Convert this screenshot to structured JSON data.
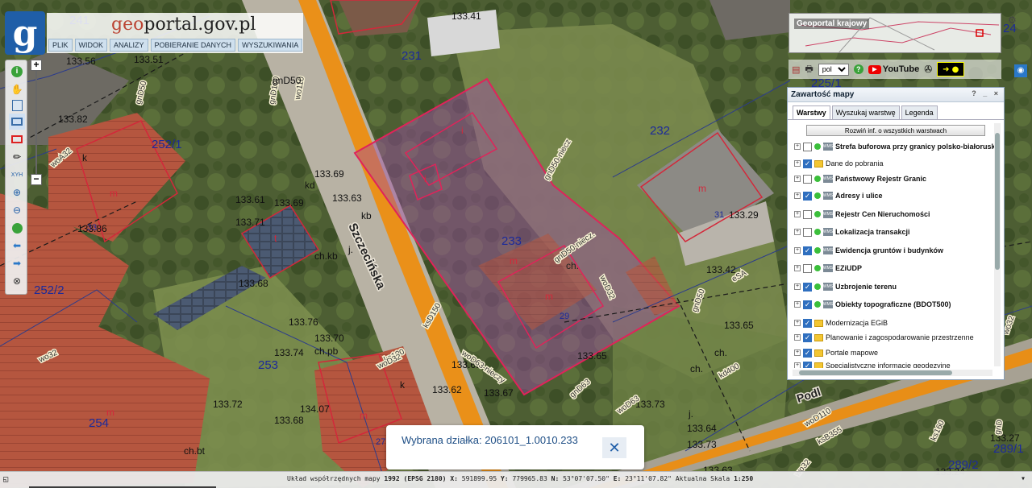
{
  "header": {
    "title_geo": "geo",
    "title_rest": "portal.gov.pl",
    "logo_letter": "g"
  },
  "menu": [
    "PLIK",
    "WIDOK",
    "ANALIZY",
    "POBIERANIE DANYCH",
    "WYSZUKIWANIA"
  ],
  "toolbar": {
    "zoom_in": "+",
    "zoom_out": "−",
    "xyh_label": "XYH"
  },
  "minimap": {
    "title": "Geoportal krajowy"
  },
  "top_icons": {
    "language": "pol",
    "youtube": "YouTube"
  },
  "panel": {
    "title": "Zawartość mapy",
    "controls": "? _ ×",
    "tabs": [
      "Warstwy",
      "Wyszukaj warstwę",
      "Legenda"
    ],
    "expand_button": "Rozwiń inf. o wszystkich warstwach",
    "layers": [
      {
        "label": "Strefa buforowa przy granicy polsko-białoruskiej",
        "checked": false,
        "kind": "wms",
        "bold": true
      },
      {
        "label": "Dane do pobrania",
        "checked": true,
        "kind": "folder",
        "bold": false
      },
      {
        "label": "Państwowy Rejestr Granic",
        "checked": false,
        "kind": "wms",
        "bold": true
      },
      {
        "label": "Adresy i ulice",
        "checked": true,
        "kind": "wms",
        "bold": true
      },
      {
        "label": "Rejestr Cen Nieruchomości",
        "checked": false,
        "kind": "wms",
        "bold": true
      },
      {
        "label": "Lokalizacja transakcji",
        "checked": false,
        "kind": "wms",
        "bold": true
      },
      {
        "label": "Ewidencja gruntów i budynków",
        "checked": true,
        "kind": "wms",
        "bold": true
      },
      {
        "label": "EZiUDP",
        "checked": false,
        "kind": "wms",
        "bold": true
      },
      {
        "label": "Uzbrojenie terenu",
        "checked": true,
        "kind": "wms",
        "bold": true
      },
      {
        "label": "Obiekty topograficzne (BDOT500)",
        "checked": true,
        "kind": "wms",
        "bold": true
      },
      {
        "label": "Modernizacja EGiB",
        "checked": true,
        "kind": "folder",
        "bold": false
      },
      {
        "label": "Planowanie i zagospodarowanie przestrzenne",
        "checked": true,
        "kind": "folder",
        "bold": false
      },
      {
        "label": "Portale mapowe",
        "checked": true,
        "kind": "folder",
        "bold": false
      },
      {
        "label": "Specjalistyczne informacje geodezyjne",
        "checked": true,
        "kind": "folder",
        "bold": false
      }
    ]
  },
  "popup": {
    "text": "Wybrana działka: 206101_1.0010.233",
    "close": "✕"
  },
  "status": {
    "crs_prefix": "Układ współrzędnych mapy",
    "crs": "1992 (EPSG 2180)",
    "x_label": "X:",
    "x": "591899.95",
    "y_label": "Y:",
    "y": "779965.83",
    "n_label": "N:",
    "n": "53°07'07.50\"",
    "e_label": "E:",
    "e": "23°11'07.82\"",
    "scale_label": "Aktualna Skala",
    "scale": "1:250"
  },
  "map": {
    "street": "Szczecińska",
    "street2": "Podl",
    "parcels": [
      "233",
      "231",
      "232",
      "252/1",
      "252/2",
      "253",
      "254",
      "241",
      "225/1",
      "289/2",
      "289/1",
      "24"
    ],
    "house_numbers": [
      "29",
      "31",
      "33",
      "27"
    ],
    "heights": [
      "133.41",
      "133.56",
      "133.51",
      "133.82",
      "133.61",
      "133.69",
      "133.63",
      "133.71",
      "133.86",
      "133.68",
      "133.76",
      "133.70",
      "133.74",
      "133.72",
      "134.07",
      "133.68",
      "133.29",
      "133.42",
      "133.65",
      "133.73",
      "133.64",
      "133.73",
      "133.63",
      "133.24",
      "133.27",
      "133.62",
      "133.67",
      "133.68",
      "133.65",
      "133.69"
    ],
    "pipes": [
      "wo110",
      "gnD100",
      "gnD50",
      "woA32",
      "wo32",
      "ks100",
      "ksD150",
      "woD32",
      "woD63-nieczy",
      "gnD50-niecz",
      "gnD50-niecz.",
      "woD32",
      "gnD63",
      "kd400",
      "woD63",
      "woD110",
      "ksB355",
      "wo32",
      "gnD50",
      "ks160",
      "eSA",
      "wo32",
      "gnD"
    ],
    "labels": [
      "m",
      "m",
      "m",
      "m",
      "m",
      "m",
      "t",
      "i",
      "i",
      "ch.",
      "ch.bt",
      "ch.pb",
      "ch.kb",
      "k",
      "k",
      "kb",
      "j.",
      "j.",
      "ch.",
      "ch.",
      "kd",
      "gnD50"
    ]
  }
}
